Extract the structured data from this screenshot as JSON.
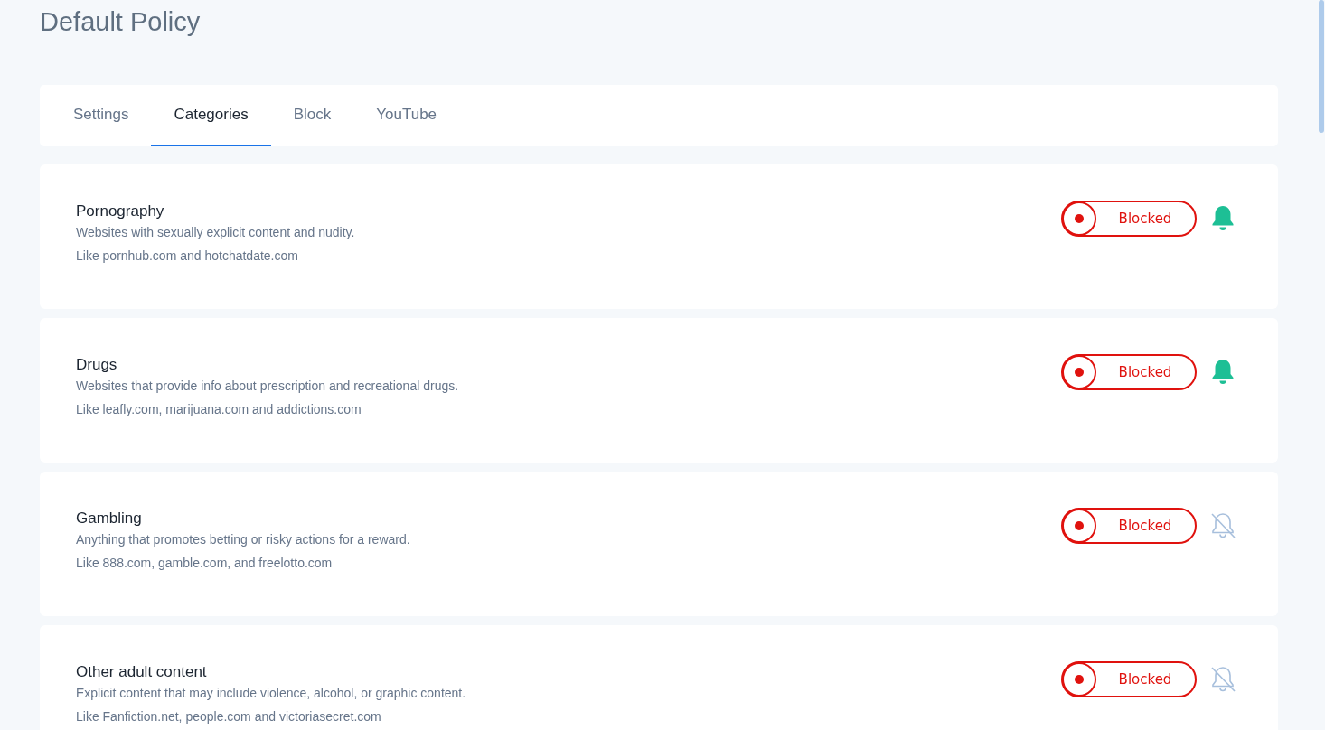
{
  "page": {
    "title": "Default Policy"
  },
  "tabs": [
    {
      "label": "Settings",
      "selected": false
    },
    {
      "label": "Categories",
      "selected": true
    },
    {
      "label": "Block",
      "selected": false
    },
    {
      "label": "YouTube",
      "selected": false
    }
  ],
  "categories": [
    {
      "name": "Pornography",
      "description": "Websites with sexually explicit content and nudity.",
      "examples": "Like pornhub.com and hotchatdate.com",
      "toggle_label": "Blocked",
      "blocked": true,
      "alerts_on": true
    },
    {
      "name": "Drugs",
      "description": "Websites that provide info about prescription and recreational drugs.",
      "examples": "Like leafly.com, marijuana.com and addictions.com",
      "toggle_label": "Blocked",
      "blocked": true,
      "alerts_on": true
    },
    {
      "name": "Gambling",
      "description": "Anything that promotes betting or risky actions for a reward.",
      "examples": "Like 888.com, gamble.com, and freelotto.com",
      "toggle_label": "Blocked",
      "blocked": true,
      "alerts_on": false
    },
    {
      "name": "Other adult content",
      "description": "Explicit content that may include violence, alcohol, or graphic content.",
      "examples": "Like Fanfiction.net, people.com and victoriasecret.com",
      "toggle_label": "Blocked",
      "blocked": true,
      "alerts_on": false
    }
  ]
}
